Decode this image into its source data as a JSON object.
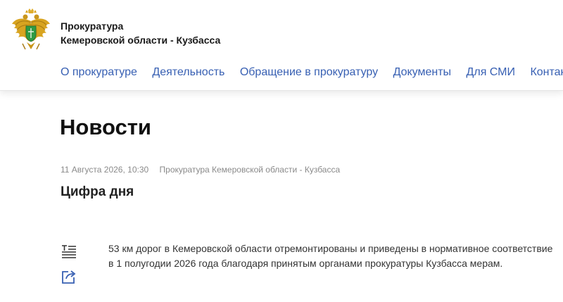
{
  "header": {
    "org_line1": "Прокуратура",
    "org_line2": "Кемеровской области - Кузбасса",
    "nav": [
      {
        "label": "О прокуратуре"
      },
      {
        "label": "Деятельность"
      },
      {
        "label": "Обращение в прокуратуру"
      },
      {
        "label": "Документы"
      },
      {
        "label": "Для СМИ"
      },
      {
        "label": "Контакты"
      }
    ]
  },
  "page": {
    "title": "Новости"
  },
  "article": {
    "date": "11 Августа 2026, 10:30",
    "source": "Прокуратура Кемеровской области - Кузбасса",
    "title": "Цифра дня",
    "text": "53 км дорог в Кемеровской области отремонтированы и приведены в нормативное соответствие в 1 полугодии 2026 года благодаря принятым органами прокуратуры Кузбасса мерам."
  },
  "icons": {
    "logo": "prosecutor-emblem-icon",
    "text_version": "text-lines-icon",
    "share": "share-icon"
  },
  "colors": {
    "link": "#3860b3",
    "meta": "#8a8a8a"
  }
}
